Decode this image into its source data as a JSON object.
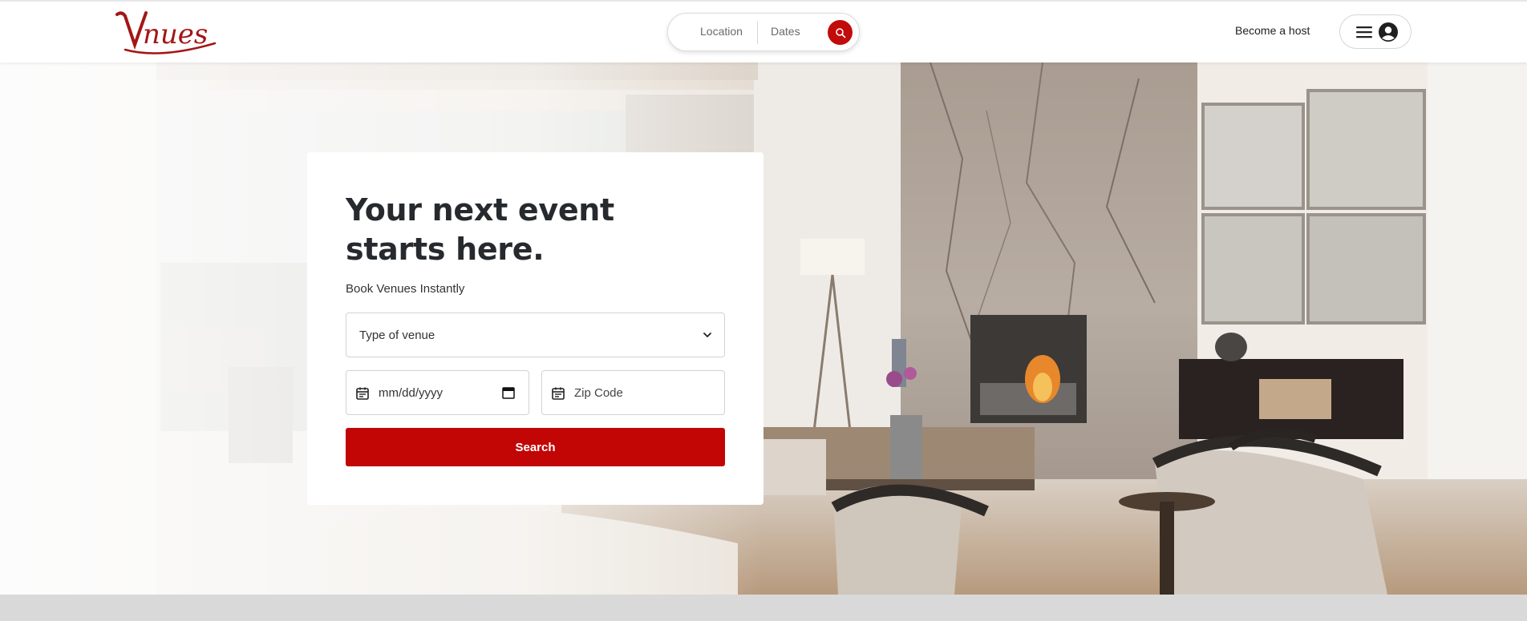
{
  "brand": {
    "logo_text": "Vnues",
    "accent_color": "#c20505"
  },
  "header": {
    "search": {
      "location_label": "Location",
      "dates_label": "Dates",
      "icon": "search-icon"
    },
    "become_host_label": "Become a host",
    "user_menu": {
      "icons": [
        "hamburger-menu-icon",
        "user-avatar-icon"
      ]
    }
  },
  "hero": {
    "title": "Your next event starts here.",
    "subtitle": "Book Venues Instantly",
    "venue_select": {
      "placeholder": "Type of venue"
    },
    "date_input": {
      "placeholder": "mm/dd/yyyy"
    },
    "zip_input": {
      "placeholder": "Zip Code"
    },
    "search_button_label": "Search"
  }
}
